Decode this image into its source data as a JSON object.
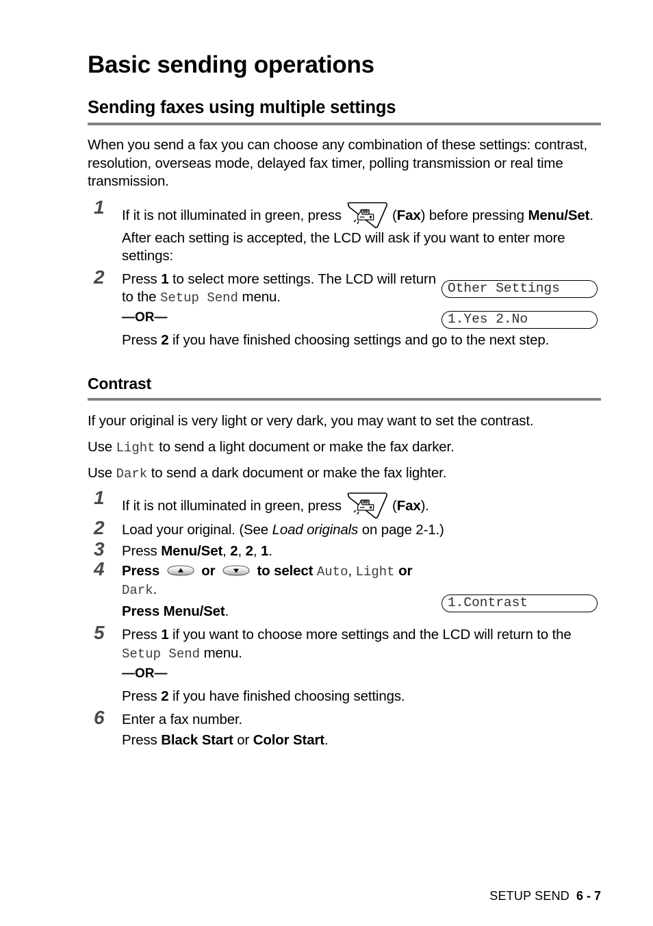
{
  "document": {
    "chapter_title": "Basic sending operations",
    "section_title": "Sending faxes using multiple settings",
    "intro_paragraph": "When you send a fax you can choose any combination of these settings: contrast, resolution, overseas mode, delayed fax timer, polling transmission or real time transmission.",
    "subsection_title": "Contrast"
  },
  "multi_settings": {
    "step1": {
      "number": "1",
      "text_before_icon": "If it is not illuminated in green, press",
      "fax_label_open": "(",
      "fax_label": "Fax",
      "fax_label_close": ")",
      "text_after_icon": " before pressing ",
      "menu_set": "Menu/Set",
      "text_tail": ". After each setting is accepted, the LCD will ask if you want to enter more settings:"
    },
    "step2": {
      "number": "2",
      "text_a": "Press ",
      "key_1": "1",
      "text_b": " to select more settings. The LCD will return to the ",
      "lcd_term": "Setup Send",
      "text_c": " menu.",
      "or": "—OR—",
      "alt_a": "Press ",
      "key_2": "2",
      "alt_b": " if you have finished choosing settings and go to the next step."
    },
    "lcd_displays": [
      {
        "id": "other-settings",
        "text": "Other Settings"
      },
      {
        "id": "yes-no",
        "text": "1.Yes 2.No"
      }
    ]
  },
  "contrast": {
    "intro_line_1": "If your original is very light or very dark, you may want to set the contrast.",
    "use_light": {
      "a": "Use ",
      "term": "Light",
      "b": " to send a light document or make the fax darker."
    },
    "use_dark": {
      "a": "Use ",
      "term": "Dark",
      "b": " to send a dark document or make the fax lighter."
    },
    "step1": {
      "number": "1",
      "text_before_icon": "If it is not illuminated in green, press",
      "fax_label_open": "(",
      "fax_label": "Fax",
      "fax_label_close": ")."
    },
    "step2": {
      "number": "2",
      "text_a": "Load your original. (See ",
      "italic_ref": "Load originals",
      "text_b": " on page 2-1.)"
    },
    "step3": {
      "number": "3",
      "text_a": "Press ",
      "menu_set": "Menu/Set",
      "text_b": ", ",
      "digit_1": "2",
      "text_c": ", ",
      "digit_2": "2",
      "text_d": ", ",
      "digit_3": "1",
      "text_e": "."
    },
    "step4": {
      "number": "4",
      "text_a": "Press ",
      "text_or": " or ",
      "text_b": " to select ",
      "opt_auto": "Auto",
      "text_c": ", ",
      "opt_light": "Light",
      "text_d": " or ",
      "opt_dark": "Dark",
      "text_e": ".",
      "press_line_a": "Press ",
      "press_menu_set": "Menu/Set",
      "press_line_b": "."
    },
    "step5": {
      "number": "5",
      "text_a": "Press ",
      "key_1": "1",
      "text_b": " if you want to choose more settings and the LCD will return to the ",
      "lcd_term": "Setup Send",
      "text_c": " menu.",
      "or": "—OR—",
      "alt_a": "Press ",
      "key_2": "2",
      "alt_b": " if you have finished choosing settings."
    },
    "step6": {
      "number": "6",
      "text_a": "Enter a fax number.",
      "press_a": "Press ",
      "black_start": "Black Start",
      "press_or": " or ",
      "color_start": "Color Start",
      "press_b": "."
    },
    "lcd_displays": [
      {
        "id": "contrast",
        "text": "1.Contrast"
      }
    ]
  },
  "icons": {
    "fax_key": "fax-machine-key-icon",
    "arrow_up": "arrow-up-key-icon",
    "arrow_down": "arrow-down-key-icon"
  },
  "footer": {
    "section_label": "SETUP SEND",
    "page_number": "6 - 7"
  },
  "colors": {
    "rule": "#818181",
    "step_number": "#4a4a4a",
    "mono_text": "#3c3c3c",
    "text": "#000000",
    "background": "#ffffff"
  }
}
